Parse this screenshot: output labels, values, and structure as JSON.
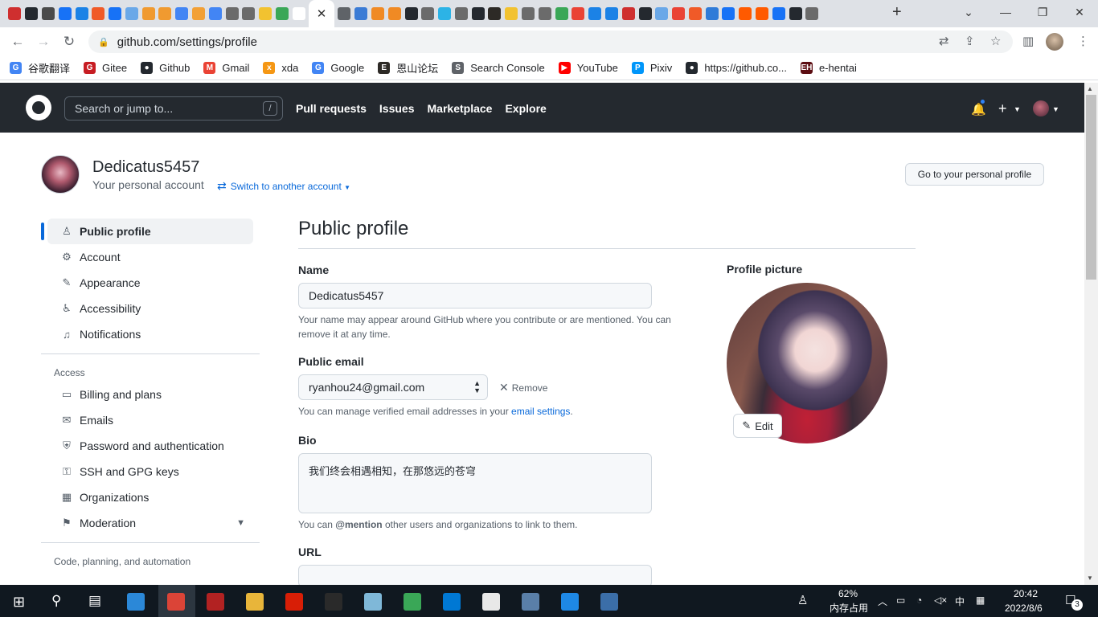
{
  "browser": {
    "url": "github.com/settings/profile",
    "tab_close": "✕",
    "new_tab": "+",
    "bookmarks": [
      {
        "label": "谷歌翻译",
        "color": "#4285f4",
        "glyph": "G"
      },
      {
        "label": "Gitee",
        "color": "#c71d23",
        "glyph": "G"
      },
      {
        "label": "Github",
        "color": "#24292f",
        "glyph": "●"
      },
      {
        "label": "Gmail",
        "color": "#ea4335",
        "glyph": "M"
      },
      {
        "label": "xda",
        "color": "#f59714",
        "glyph": "x"
      },
      {
        "label": "Google",
        "color": "#4285f4",
        "glyph": "G"
      },
      {
        "label": "恩山论坛",
        "color": "#2d2a26",
        "glyph": "E"
      },
      {
        "label": "Search Console",
        "color": "#5f6368",
        "glyph": "S"
      },
      {
        "label": "YouTube",
        "color": "#ff0000",
        "glyph": "▶"
      },
      {
        "label": "Pixiv",
        "color": "#0096fa",
        "glyph": "P"
      },
      {
        "label": "https://github.co...",
        "color": "#24292f",
        "glyph": "●"
      },
      {
        "label": "e-hentai",
        "color": "#5c0d12",
        "glyph": "EH"
      }
    ]
  },
  "header": {
    "search_placeholder": "Search or jump to...",
    "search_key": "/",
    "nav": [
      "Pull requests",
      "Issues",
      "Marketplace",
      "Explore"
    ]
  },
  "account": {
    "username": "Dedicatus5457",
    "subtitle": "Your personal account",
    "switch_label": "Switch to another account",
    "profile_button": "Go to your personal profile"
  },
  "sidebar": {
    "items": [
      {
        "label": "Public profile",
        "icon": "person-icon",
        "glyph": "♙"
      },
      {
        "label": "Account",
        "icon": "gear-icon",
        "glyph": "⚙"
      },
      {
        "label": "Appearance",
        "icon": "paintbrush-icon",
        "glyph": "✎"
      },
      {
        "label": "Accessibility",
        "icon": "accessibility-icon",
        "glyph": "♿"
      },
      {
        "label": "Notifications",
        "icon": "bell-icon",
        "glyph": "🔔"
      }
    ],
    "access_heading": "Access",
    "access_items": [
      {
        "label": "Billing and plans",
        "icon": "credit-card-icon",
        "glyph": "▭"
      },
      {
        "label": "Emails",
        "icon": "mail-icon",
        "glyph": "✉"
      },
      {
        "label": "Password and authentication",
        "icon": "shield-icon",
        "glyph": "⛨"
      },
      {
        "label": "SSH and GPG keys",
        "icon": "key-icon",
        "glyph": "⚿"
      },
      {
        "label": "Organizations",
        "icon": "organization-icon",
        "glyph": "▦"
      },
      {
        "label": "Moderation",
        "icon": "report-icon",
        "glyph": "⚑"
      }
    ],
    "code_heading": "Code, planning, and automation"
  },
  "main": {
    "title": "Public profile",
    "name_label": "Name",
    "name_value": "Dedicatus5457",
    "name_note": "Your name may appear around GitHub where you contribute or are mentioned. You can remove it at any time.",
    "email_label": "Public email",
    "email_value": "ryanhou24@gmail.com",
    "remove_label": "Remove",
    "email_note_pre": "You can manage verified email addresses in your ",
    "email_note_link": "email settings",
    "email_note_post": ".",
    "bio_label": "Bio",
    "bio_value": "我们终会相遇相知，在那悠远的苍穹",
    "bio_note_pre": "You can ",
    "bio_note_bold": "@mention",
    "bio_note_post": " other users and organizations to link to them.",
    "url_label": "URL",
    "picture_label": "Profile picture",
    "edit_label": "Edit"
  },
  "taskbar": {
    "memory_pct": "62%",
    "memory_label": "内存占用",
    "ime": "中",
    "time": "20:42",
    "date": "2022/8/6",
    "notif_count": "3"
  },
  "colors": {
    "github_header": "#24292f",
    "link_blue": "#0969da",
    "active_indicator": "#0969da"
  }
}
